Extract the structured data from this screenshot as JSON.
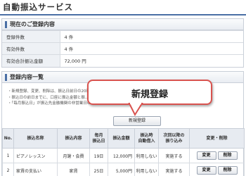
{
  "page_title": "自動振込サービス",
  "current_section": {
    "title": "現在のご登録内容",
    "rows": [
      {
        "label": "登録件数",
        "value": "4 件"
      },
      {
        "label": "有効件数",
        "value": "4 件"
      },
      {
        "label": "有効合計振込金額",
        "value": "72,000 円"
      }
    ]
  },
  "list_section": {
    "title": "登録内容一覧",
    "notes": [
      "・新規登録、変更、削除は、振込日前日の20時...",
      "・振込日の前日までに、口座に振込金額と振...",
      "・「毎月振込日」が振込先金融機関の非営業日の場合は、前営業日に振込されます。"
    ],
    "new_button_small": "新規登録",
    "headers": [
      "No.",
      "振込名称",
      "振込内容",
      "毎月\n振込日",
      "振込金額",
      "振込時\n自動借入",
      "次回以降の\n振り込み",
      "変更・削除"
    ],
    "rows": [
      {
        "no": "1",
        "name": "ピアノレッスン",
        "content": "月謝・会費",
        "day": "19日",
        "amount": "12,000円",
        "auto_loan": "利用しない",
        "next": "実施する",
        "edit": "変更",
        "delete": "削除"
      },
      {
        "no": "2",
        "name": "家賃の支払い",
        "content": "家賃",
        "day": "25日",
        "amount": "5,000円",
        "auto_loan": "利用しない",
        "next": "実施する",
        "edit": "変更",
        "delete": "削除"
      }
    ]
  },
  "callout_label": "新規登録",
  "colors": {
    "accent": "#4a6fa5",
    "callout_border": "#d9534f"
  }
}
